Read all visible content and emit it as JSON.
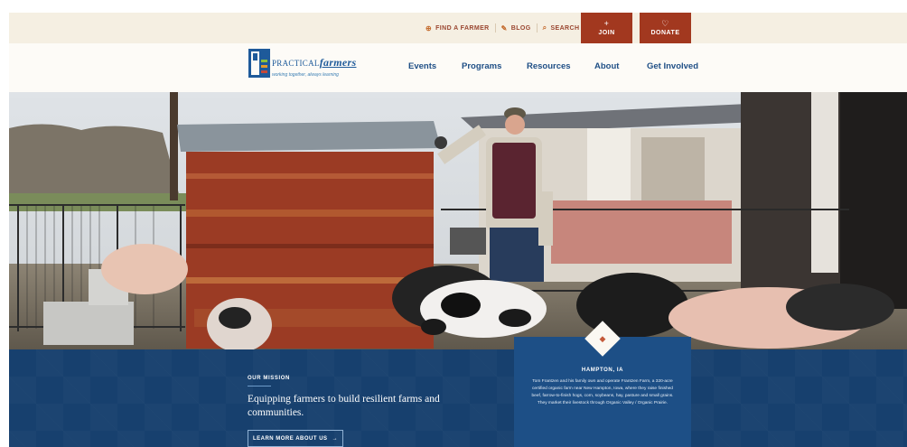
{
  "utility": {
    "links": [
      {
        "label": "FIND A FARMER",
        "icon": "globe-icon"
      },
      {
        "label": "BLOG",
        "icon": "pencil-icon"
      },
      {
        "label": "SEARCH",
        "icon": "search-icon"
      }
    ],
    "join": {
      "label": "JOIN",
      "icon": "plus-icon"
    },
    "donate": {
      "label": "DONATE",
      "icon": "heart-icon"
    }
  },
  "logo": {
    "word_small": "PRACTICAL",
    "word_big": "farmers",
    "tagline": "working together, always learning"
  },
  "nav": {
    "items": [
      "Events",
      "Programs",
      "Resources",
      "About",
      "Get Involved"
    ]
  },
  "mission": {
    "eyebrow": "OUR MISSION",
    "text": "Equipping farmers to build resilient farms and communities.",
    "button": "LEARN MORE ABOUT US",
    "button_icon": "arrow-right-icon"
  },
  "caption": {
    "icon": "map-pin-icon",
    "location": "HAMPTON, IA",
    "body": "Tom Frantzen and his family own and operate Frantzen Farm, a 320-acre certified organic farm near New Hampton, Iowa, where they raise finished beef, farrow-to-finish hogs, corn, soybeans, hay, pasture and small grains. They market their livestock through Organic Valley / Organic Prairie."
  },
  "colors": {
    "brand_red": "#a2381f",
    "brand_blue": "#1f4f86",
    "band_blue": "#17406e",
    "cream": "#f5efe2"
  }
}
